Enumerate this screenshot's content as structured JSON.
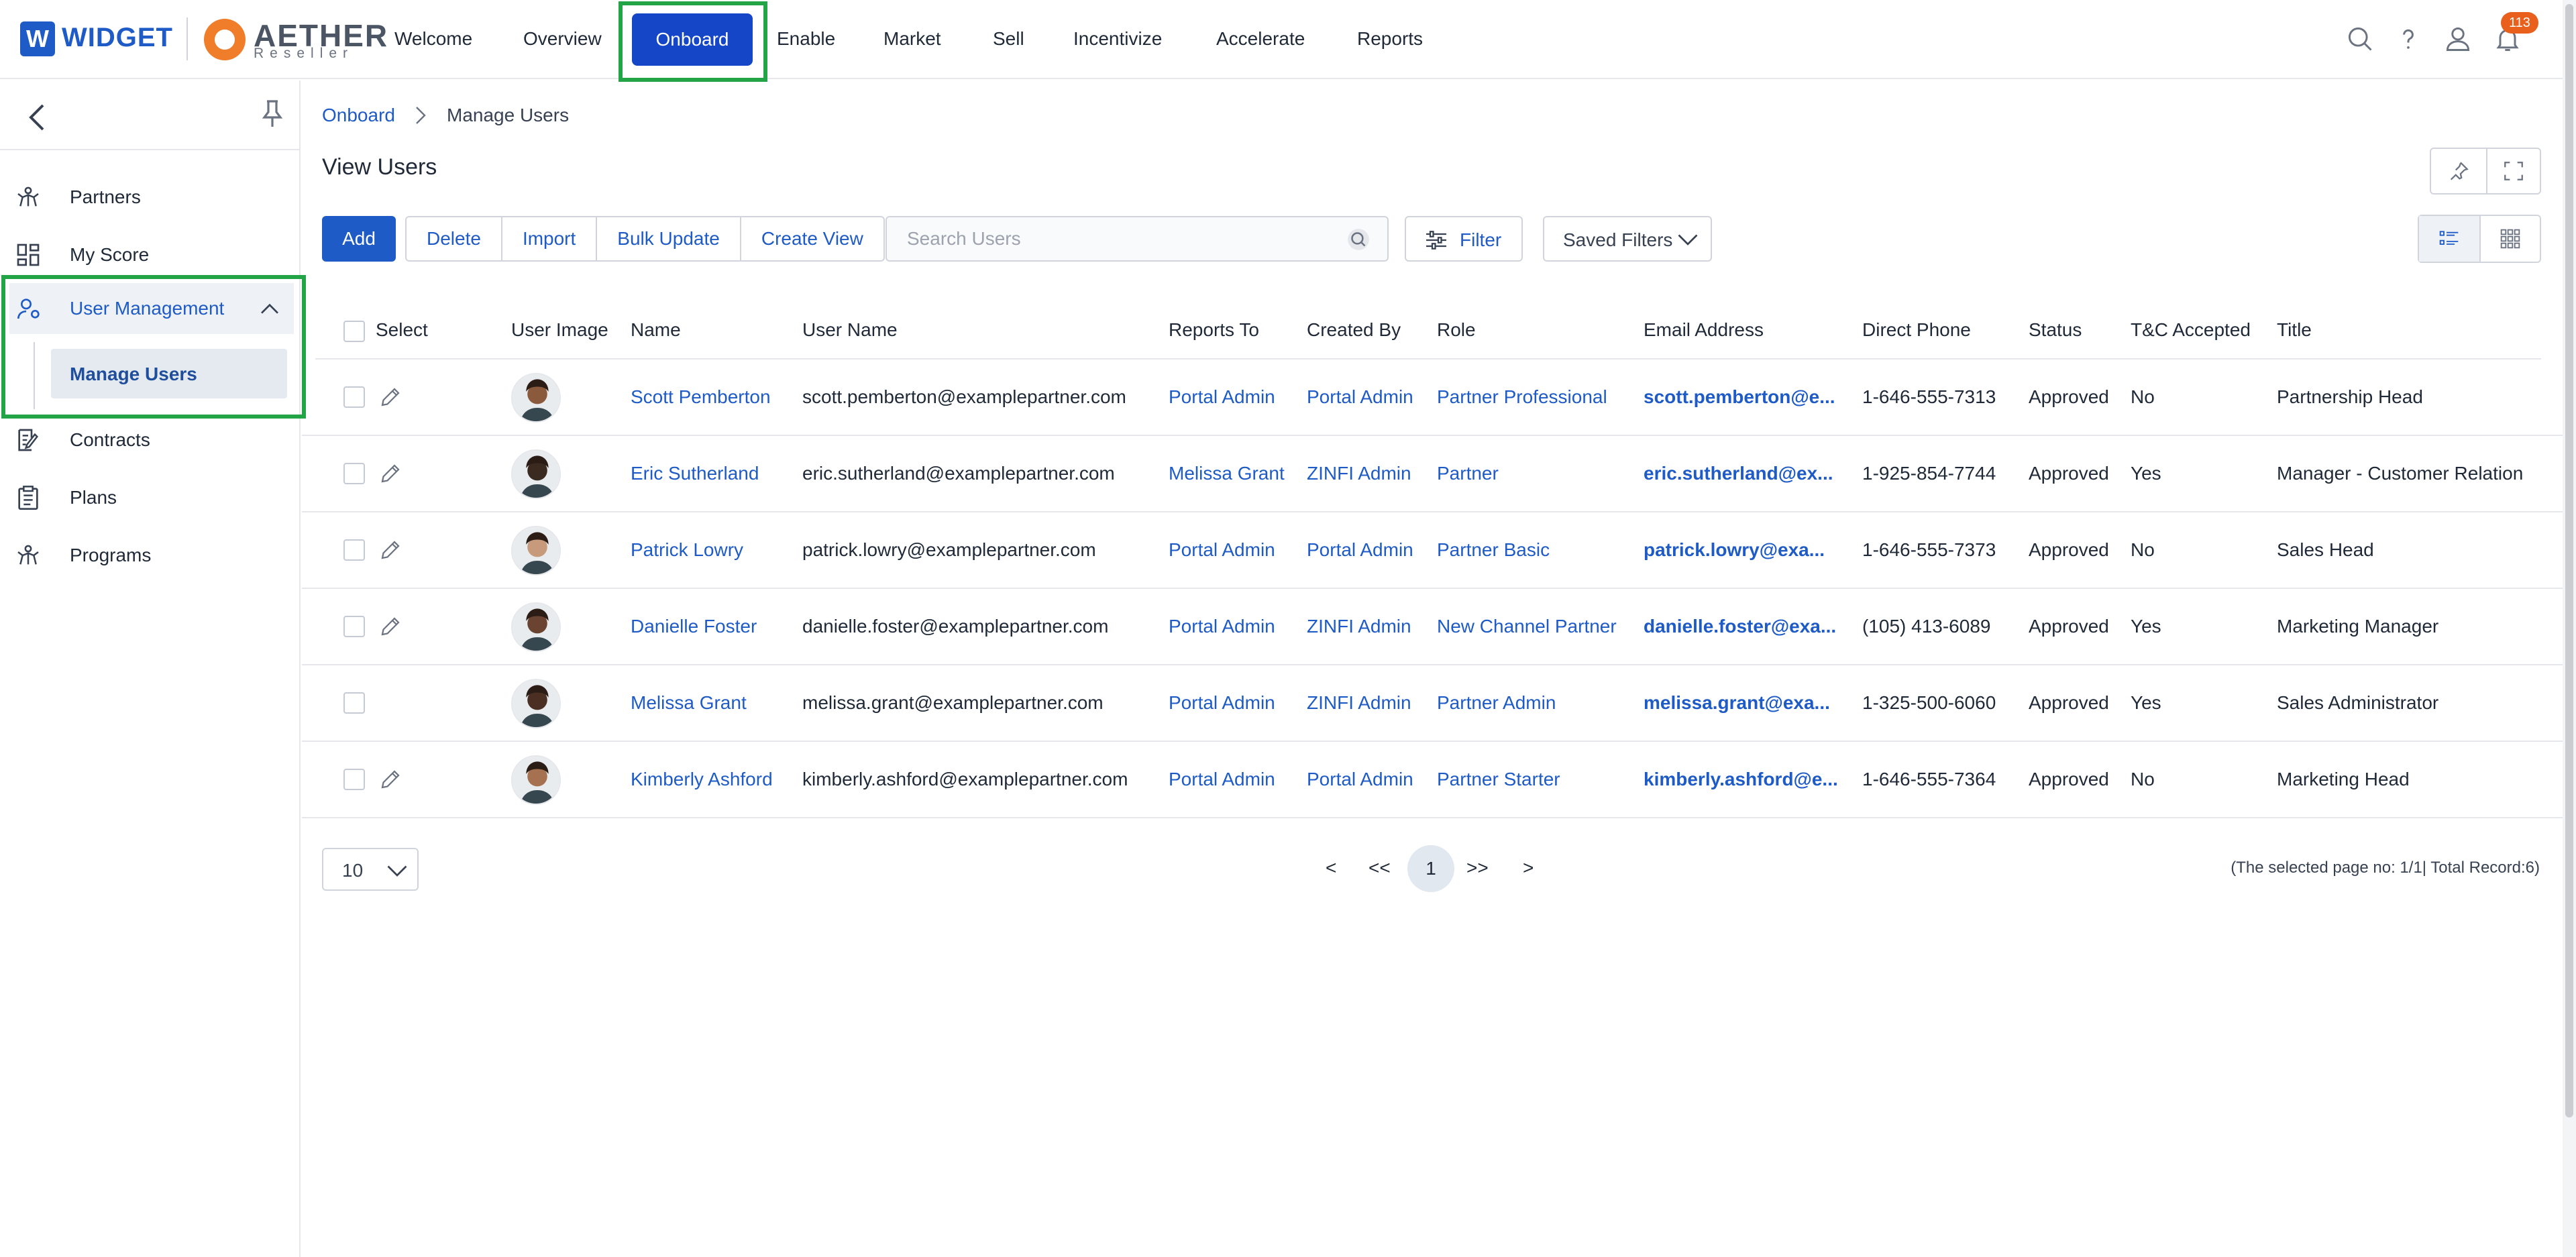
{
  "brand": {
    "widget_letter": "W",
    "widget_name": "WIDGET",
    "aether_name": "AETHER",
    "aether_sub": "Reseller"
  },
  "nav": {
    "welcome": "Welcome",
    "overview": "Overview",
    "onboard": "Onboard",
    "enable": "Enable",
    "market": "Market",
    "sell": "Sell",
    "incentivize": "Incentivize",
    "accelerate": "Accelerate",
    "reports": "Reports"
  },
  "notifications": {
    "count": "113"
  },
  "sidebar": {
    "partners": "Partners",
    "my_score": "My Score",
    "user_management": "User Management",
    "manage_users": "Manage Users",
    "contracts": "Contracts",
    "plans": "Plans",
    "programs": "Programs"
  },
  "breadcrumb": {
    "root": "Onboard",
    "current": "Manage Users"
  },
  "page": {
    "title": "View Users"
  },
  "toolbar": {
    "add": "Add",
    "delete": "Delete",
    "import": "Import",
    "bulk_update": "Bulk Update",
    "create_view": "Create View",
    "search_placeholder": "Search Users",
    "filter": "Filter",
    "saved_filters": "Saved Filters"
  },
  "table": {
    "headers": {
      "select": "Select",
      "user_image": "User Image",
      "name": "Name",
      "user_name": "User Name",
      "reports_to": "Reports To",
      "created_by": "Created By",
      "role": "Role",
      "email": "Email Address",
      "phone": "Direct Phone",
      "status": "Status",
      "tnc": "T&C Accepted",
      "title": "Title"
    },
    "rows": [
      {
        "name": "Scott Pemberton",
        "user_name": "scott.pemberton@examplepartner.com",
        "reports_to": "Portal Admin",
        "created_by": "Portal Admin",
        "role": "Partner Professional",
        "email": "scott.pemberton@e...",
        "phone": "1-646-555-7313",
        "status": "Approved",
        "tnc": "No",
        "title": "Partnership Head"
      },
      {
        "name": "Eric Sutherland",
        "user_name": "eric.sutherland@examplepartner.com",
        "reports_to": "Melissa Grant",
        "created_by": "ZINFI Admin",
        "role": "Partner",
        "email": "eric.sutherland@ex...",
        "phone": "1-925-854-7744",
        "status": "Approved",
        "tnc": "Yes",
        "title": "Manager - Customer Relation"
      },
      {
        "name": "Patrick Lowry",
        "user_name": "patrick.lowry@examplepartner.com",
        "reports_to": "Portal Admin",
        "created_by": "Portal Admin",
        "role": "Partner Basic",
        "email": "patrick.lowry@exa...",
        "phone": "1-646-555-7373",
        "status": "Approved",
        "tnc": "No",
        "title": "Sales Head"
      },
      {
        "name": "Danielle Foster",
        "user_name": "danielle.foster@examplepartner.com",
        "reports_to": "Portal Admin",
        "created_by": "ZINFI Admin",
        "role": "New Channel Partner",
        "email": "danielle.foster@exa...",
        "phone": "(105) 413-6089",
        "status": "Approved",
        "tnc": "Yes",
        "title": "Marketing Manager"
      },
      {
        "name": "Melissa Grant",
        "user_name": "melissa.grant@examplepartner.com",
        "reports_to": "Portal Admin",
        "created_by": "ZINFI Admin",
        "role": "Partner Admin",
        "email": "melissa.grant@exa...",
        "phone": "1-325-500-6060",
        "status": "Approved",
        "tnc": "Yes",
        "title": "Sales Administrator"
      },
      {
        "name": "Kimberly Ashford",
        "user_name": "kimberly.ashford@examplepartner.com",
        "reports_to": "Portal Admin",
        "created_by": "Portal Admin",
        "role": "Partner Starter",
        "email": "kimberly.ashford@e...",
        "phone": "1-646-555-7364",
        "status": "Approved",
        "tnc": "No",
        "title": "Marketing Head"
      }
    ]
  },
  "pager": {
    "page_size": "10",
    "prev": "<",
    "first": "<<",
    "current": "1",
    "last": ">>",
    "next": ">",
    "info": "(The selected page no: 1/1| Total Record:6)"
  },
  "colors": {
    "accent": "#1e5bc6",
    "onboard_active": "#1546c7",
    "highlight_box": "#22a447",
    "badge": "#e8601c"
  }
}
